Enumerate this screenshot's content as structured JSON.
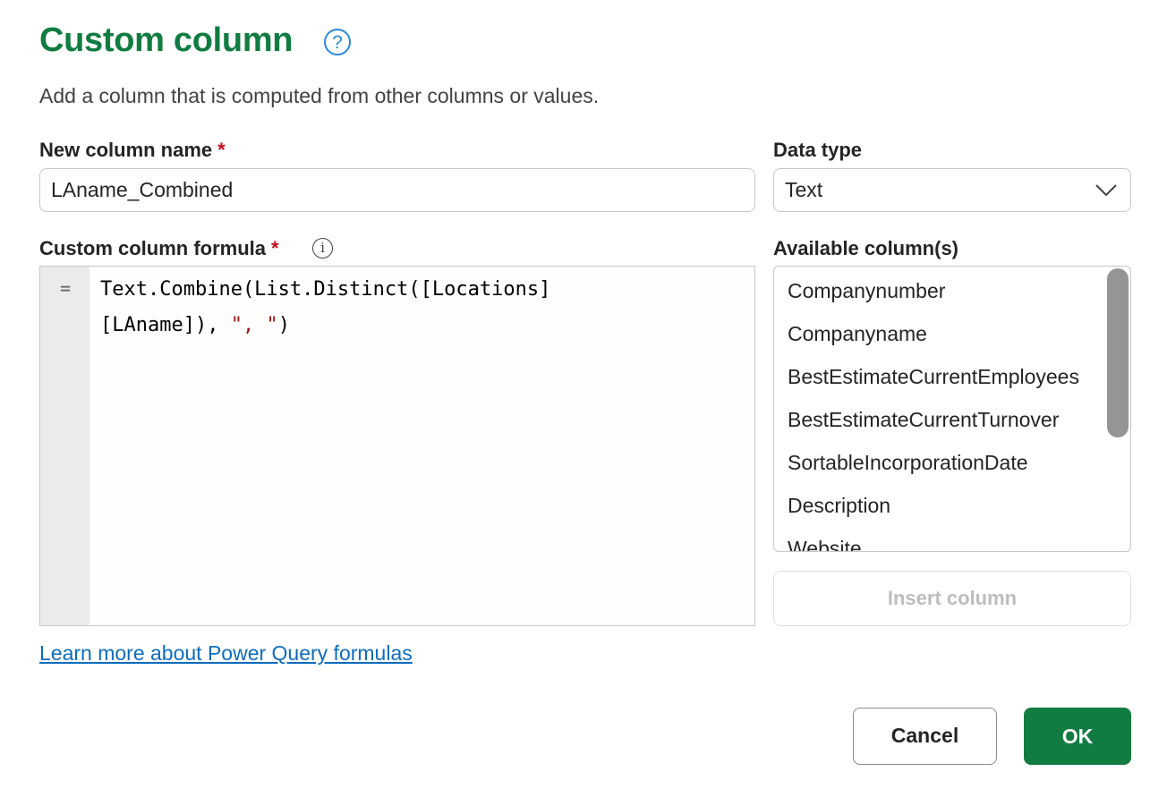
{
  "dialog": {
    "title": "Custom column",
    "help_icon": "question-circle-icon",
    "subtitle": "Add a column that is computed from other columns or values."
  },
  "new_column": {
    "label": "New column name",
    "required_marker": "*",
    "value": "LAname_Combined"
  },
  "data_type": {
    "label": "Data type",
    "selected": "Text",
    "icon": "chevron-down-icon"
  },
  "formula": {
    "label": "Custom column formula",
    "required_marker": "*",
    "info_icon": "info-icon",
    "gutter_symbol": "=",
    "line1": "Text.Combine(List.Distinct([Locations]",
    "line2_code": "[LAname]), ",
    "line2_string": "\", \"",
    "line2_end": ")"
  },
  "available_columns": {
    "label": "Available column(s)",
    "items": [
      "Companynumber",
      "Companyname",
      "BestEstimateCurrentEmployees",
      "BestEstimateCurrentTurnover",
      "SortableIncorporationDate",
      "Description",
      "Website"
    ]
  },
  "buttons": {
    "insert_column": "Insert column",
    "cancel": "Cancel",
    "ok": "OK"
  },
  "link": {
    "text": "Learn more about Power Query formulas"
  },
  "colors": {
    "accent": "#107c41",
    "link": "#0f6cbd",
    "required": "#c50f1f",
    "string_literal": "#a31515"
  }
}
